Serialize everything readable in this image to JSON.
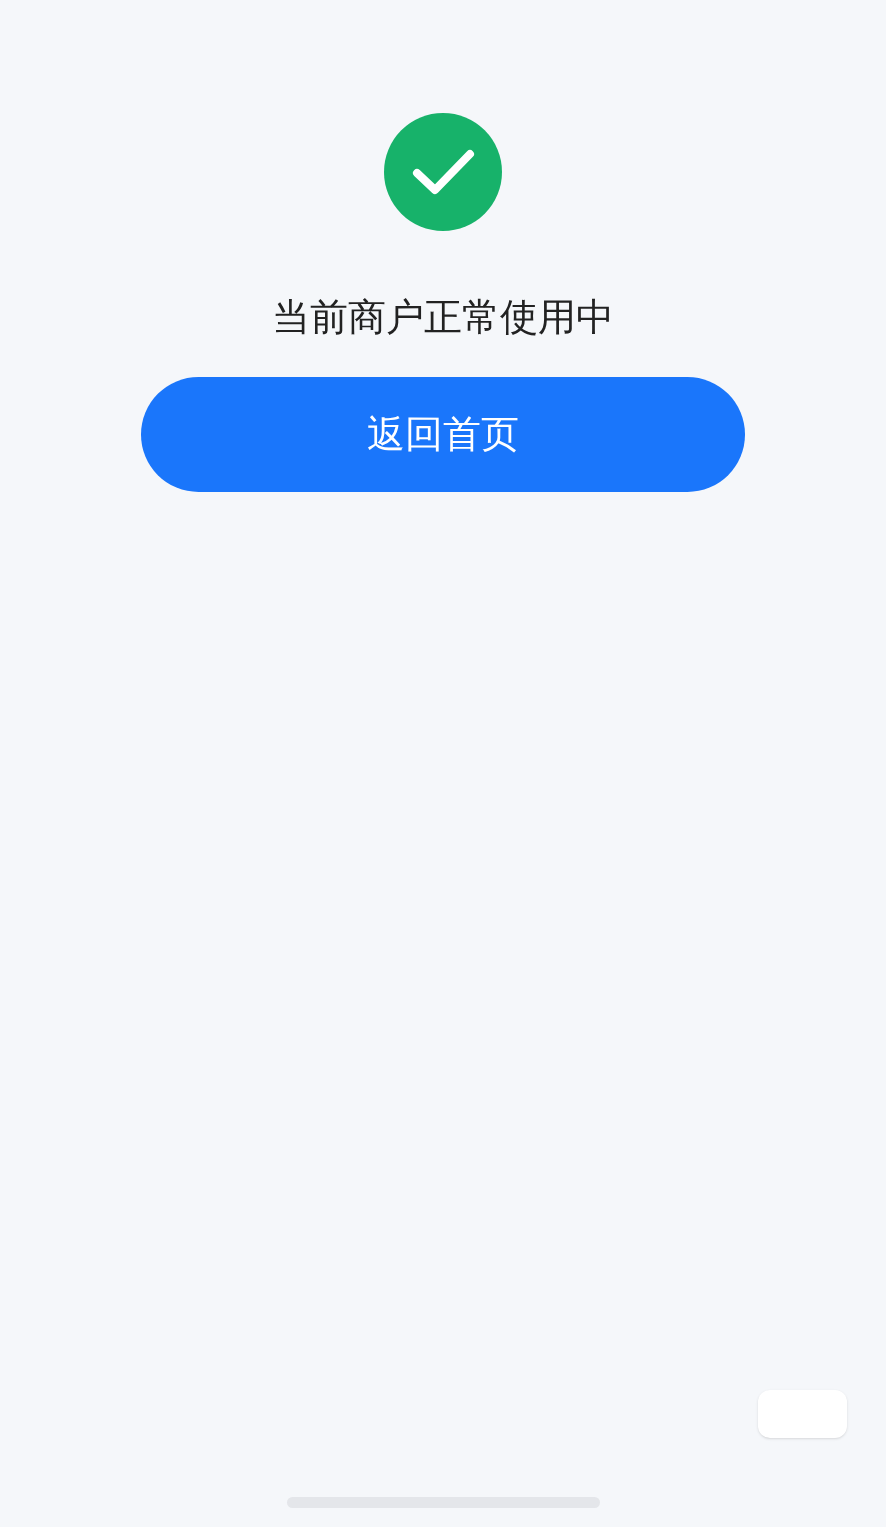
{
  "status": {
    "message": "当前商户正常使用中"
  },
  "primary_button": {
    "label": "返回首页"
  }
}
